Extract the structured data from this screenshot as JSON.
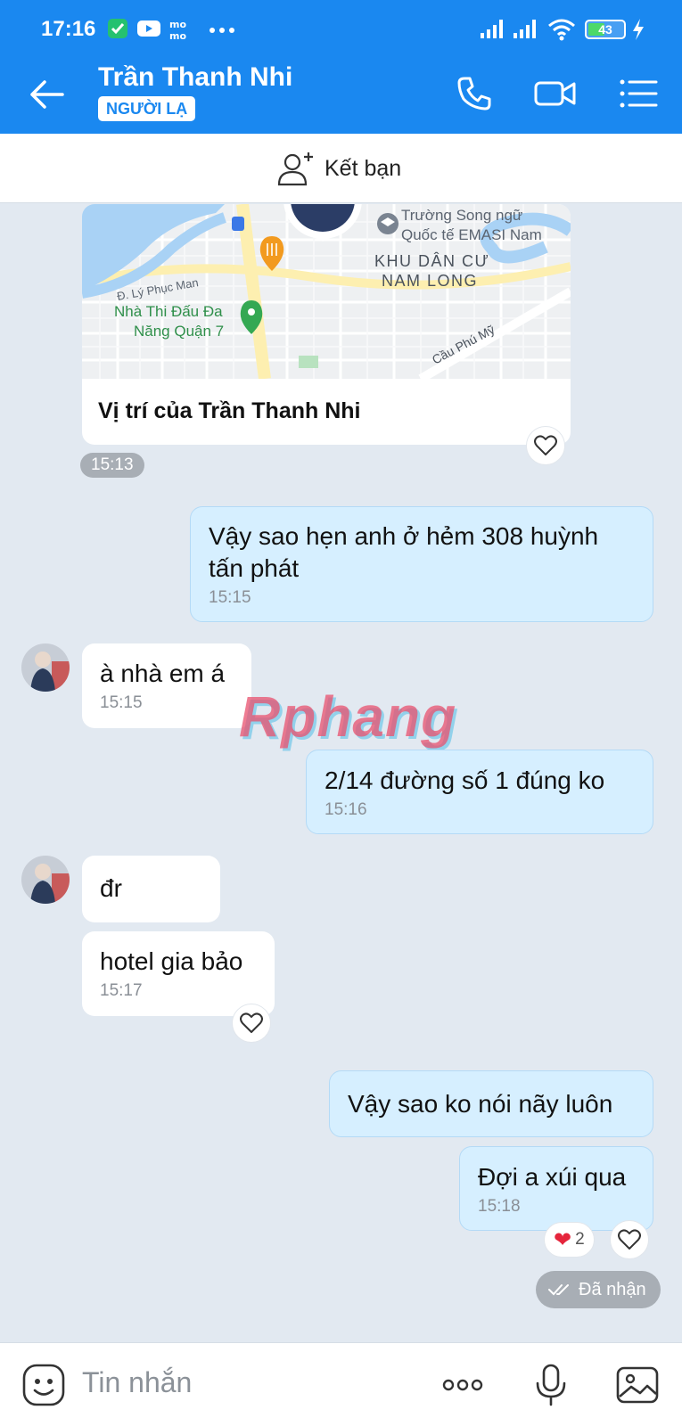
{
  "status_bar": {
    "time": "17:16",
    "battery": "43",
    "icons": [
      "check-app-icon",
      "youtube-icon",
      "momo-icon",
      "more-dots-icon",
      "signal-icon",
      "signal-icon",
      "wifi-icon",
      "battery-icon",
      "charging-icon"
    ]
  },
  "header": {
    "contact_name": "Trần Thanh Nhi",
    "badge": "NGƯỜI LẠ"
  },
  "add_friend": {
    "label": "Kết bạn"
  },
  "map": {
    "labels": {
      "school1": "Trường Song ngữ",
      "school2": "Quốc tế EMASI Nam",
      "area1": "KHU DÂN CƯ",
      "area2": "NAM LONG",
      "street": "Đ. Lý Phục Man",
      "arena1": "Nhà Thi Đấu Đa",
      "arena2": "Năng Quận 7",
      "bridge": "Cầu Phú Mỹ"
    },
    "caption": "Vị trí của Trần Thanh Nhi",
    "time": "15:13"
  },
  "messages": [
    {
      "side": "out",
      "text_line1": "Vậy sao hẹn anh ở hẻm 308 huỳnh",
      "text_line2": "tấn phát",
      "time": "15:15"
    },
    {
      "side": "in",
      "text": "à nhà em á",
      "time": "15:15"
    },
    {
      "side": "out",
      "text": "2/14 đường số 1 đúng ko",
      "time": "15:16"
    },
    {
      "side": "in",
      "text": "đr"
    },
    {
      "side": "in",
      "text": "hotel gia bảo",
      "time": "15:17"
    },
    {
      "side": "out",
      "text": "Vậy sao ko nói nãy luôn"
    },
    {
      "side": "out",
      "text": "Đợi a xúi qua",
      "time": "15:18"
    }
  ],
  "reaction": {
    "emoji": "❤",
    "count": "2"
  },
  "delivery_status": "Đã nhận",
  "watermark": "Rphang",
  "input": {
    "placeholder": "Tin nhắn"
  },
  "colors": {
    "brand": "#1a88f0",
    "chat_bg": "#e2e9f1",
    "outgoing_bubble": "#d6efff",
    "incoming_bubble": "#ffffff"
  }
}
